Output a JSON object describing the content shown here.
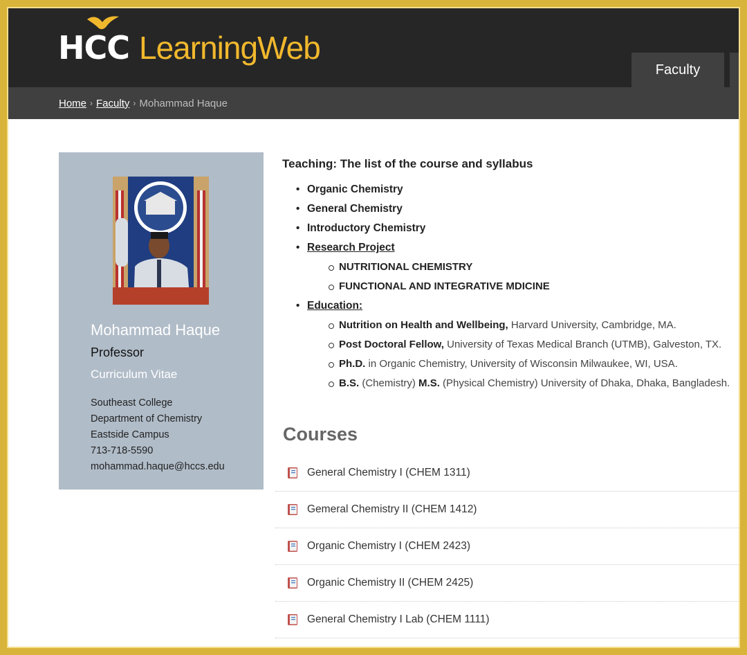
{
  "header": {
    "logo_hcc": "HCC",
    "logo_learningweb": "LearningWeb",
    "nav_tab": "Faculty"
  },
  "breadcrumb": {
    "home": "Home",
    "faculty": "Faculty",
    "current": "Mohammad Haque",
    "separator": "›"
  },
  "profile": {
    "name": "Mohammad Haque",
    "title": "Professor",
    "cv_label": "Curriculum Vitae",
    "college": "Southeast College",
    "department": "Department of Chemistry",
    "campus": "Eastside Campus",
    "phone": "713-718-5590",
    "email": "mohammad.haque@hccs.edu"
  },
  "teaching": {
    "heading": "Teaching: The list of the course and syllabus",
    "items": [
      "Organic Chemistry",
      "General Chemistry",
      "Introductory Chemistry"
    ],
    "research_label": "Research Project",
    "research_items": [
      "NUTRITIONAL CHEMISTRY",
      "FUNCTIONAL AND INTEGRATIVE MDICINE"
    ],
    "education_label": "Education:",
    "education": [
      {
        "bold": "Nutrition on Health and Wellbeing,",
        "rest": " Harvard University, Cambridge, MA."
      },
      {
        "bold": "Post Doctoral Fellow,",
        "rest": " University of Texas Medical Branch (UTMB), Galveston, TX."
      },
      {
        "bold": "Ph.D.",
        "rest": " in Organic Chemistry, University of Wisconsin Milwaukee, WI, USA."
      },
      {
        "bold": "B.S.",
        "rest": " (Chemistry) ",
        "bold2": "M.S.",
        "rest2": " (Physical Chemistry) University of Dhaka, Dhaka, Bangladesh."
      }
    ]
  },
  "courses": {
    "heading": "Courses",
    "items": [
      "General Chemistry I (CHEM 1311)",
      "Gemeral Chemistry II (CHEM 1412)",
      "Organic Chemistry I (CHEM 2423)",
      "Organic Chemistry II (CHEM 2425)",
      "General Chemistry I Lab (CHEM 1111)"
    ]
  },
  "colors": {
    "topbar": "#262626",
    "breadcrumb_bar": "#404040",
    "accent_gold": "#f1b82d",
    "sidebar": "#b0bcc8",
    "frame_gold": "#d9b43a"
  }
}
